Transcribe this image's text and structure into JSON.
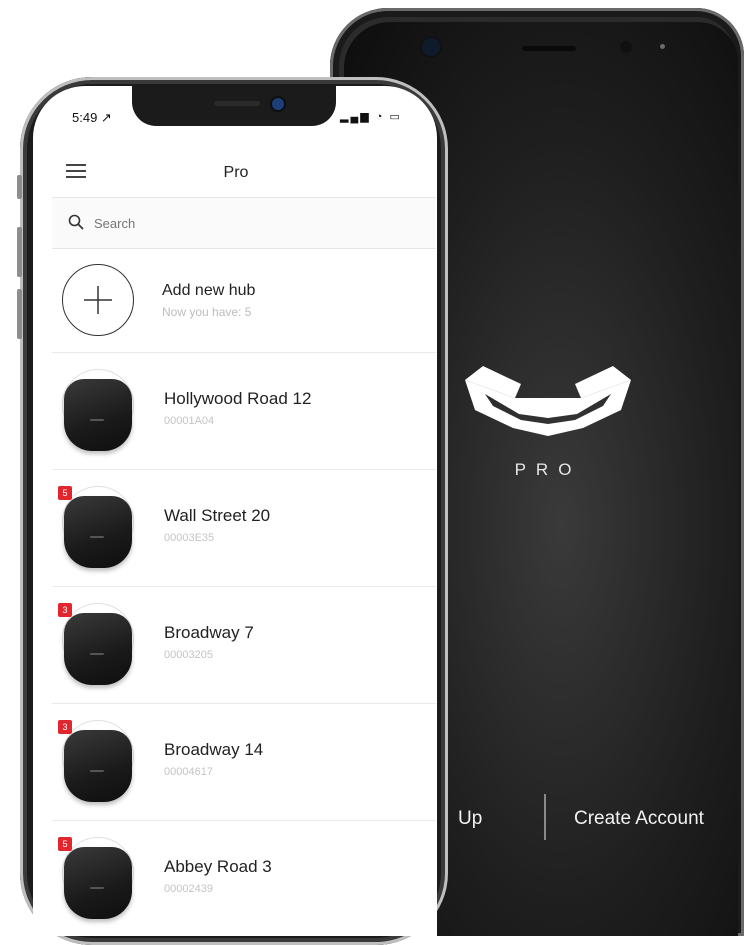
{
  "android": {
    "brand_text": "PRO",
    "signup_label": "Up",
    "create_account_label": "Create Account",
    "brand_color": "#ffffff"
  },
  "iphone": {
    "status_time": "5:49 ↗",
    "status_icons": "▂▄▆ ◔ ▭",
    "nav_title": "Pro",
    "search": {
      "placeholder": "Search"
    },
    "add_hub": {
      "title": "Add new hub",
      "subtitle": "Now you have: 5"
    },
    "hubs": [
      {
        "name": "Hollywood Road 12",
        "id": "00001A04",
        "badge": ""
      },
      {
        "name": "Wall Street 20",
        "id": "00003E35",
        "badge": "5"
      },
      {
        "name": "Broadway 7",
        "id": "00003205",
        "badge": "3"
      },
      {
        "name": "Broadway 14",
        "id": "00004617",
        "badge": "3"
      },
      {
        "name": "Abbey Road 3",
        "id": "00002439",
        "badge": "5"
      }
    ],
    "badge_color": "#e1262d"
  }
}
